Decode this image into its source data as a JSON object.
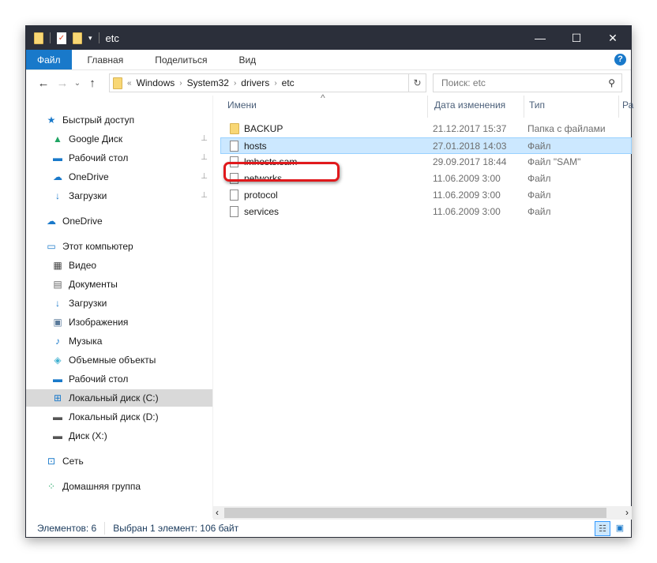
{
  "title": "etc",
  "window_controls": {
    "minimize": "—",
    "maximize": "☐",
    "close": "✕"
  },
  "ribbon": {
    "tabs": [
      "Файл",
      "Главная",
      "Поделиться",
      "Вид"
    ],
    "help": "?"
  },
  "address": {
    "overflow": "«",
    "parts": [
      "Windows",
      "System32",
      "drivers",
      "etc"
    ],
    "refresh": "↻",
    "search_placeholder": "Поиск: etc",
    "search_icon": "⚲"
  },
  "nav": {
    "back": "←",
    "forward": "→",
    "recent": "⌄",
    "up": "↑"
  },
  "sidebar": {
    "items": [
      {
        "label": "Быстрый доступ",
        "icon": "star-icon",
        "glyph": "★",
        "color": "#1979ca"
      },
      {
        "label": "Google Диск",
        "icon": "google-drive-icon",
        "glyph": "▲",
        "color": "#1fa463",
        "pinned": true
      },
      {
        "label": "Рабочий стол",
        "icon": "desktop-icon",
        "glyph": "▬",
        "color": "#1979ca",
        "pinned": true
      },
      {
        "label": "OneDrive",
        "icon": "onedrive-icon",
        "glyph": "☁",
        "color": "#1979ca",
        "pinned": true
      },
      {
        "label": "Загрузки",
        "icon": "downloads-icon",
        "glyph": "↓",
        "color": "#1979ca",
        "pinned": true
      },
      {
        "label": "OneDrive",
        "icon": "onedrive-icon",
        "glyph": "☁",
        "color": "#1979ca"
      },
      {
        "label": "Этот компьютер",
        "icon": "computer-icon",
        "glyph": "▭",
        "color": "#1979ca"
      },
      {
        "label": "Видео",
        "icon": "video-icon",
        "glyph": "▦",
        "color": "#444"
      },
      {
        "label": "Документы",
        "icon": "documents-icon",
        "glyph": "▤",
        "color": "#666"
      },
      {
        "label": "Загрузки",
        "icon": "downloads-icon",
        "glyph": "↓",
        "color": "#1979ca"
      },
      {
        "label": "Изображения",
        "icon": "pictures-icon",
        "glyph": "▣",
        "color": "#5a7a9a"
      },
      {
        "label": "Музыка",
        "icon": "music-icon",
        "glyph": "♪",
        "color": "#1979ca"
      },
      {
        "label": "Объемные объекты",
        "icon": "3d-objects-icon",
        "glyph": "◈",
        "color": "#3fb0d0"
      },
      {
        "label": "Рабочий стол",
        "icon": "desktop-icon",
        "glyph": "▬",
        "color": "#1979ca"
      },
      {
        "label": "Локальный диск (C:)",
        "icon": "windows-drive-icon",
        "glyph": "⊞",
        "color": "#1979ca",
        "selected": true
      },
      {
        "label": "Локальный диск (D:)",
        "icon": "drive-icon",
        "glyph": "▬",
        "color": "#555"
      },
      {
        "label": "Диск (X:)",
        "icon": "drive-icon",
        "glyph": "▬",
        "color": "#555"
      },
      {
        "label": "Сеть",
        "icon": "network-icon",
        "glyph": "⊡",
        "color": "#1979ca"
      },
      {
        "label": "Домашняя группа",
        "icon": "homegroup-icon",
        "glyph": "⁘",
        "color": "#1fa463"
      }
    ],
    "pin_glyph": "📌"
  },
  "columns": {
    "name": "Имени",
    "date": "Дата изменения",
    "type": "Тип",
    "size": "Ра",
    "sort": "^"
  },
  "files": [
    {
      "name": "BACKUP",
      "date": "21.12.2017 15:37",
      "type": "Папка с файлами",
      "folder": true
    },
    {
      "name": "hosts",
      "date": "27.01.2018 14:03",
      "type": "Файл",
      "selected": true
    },
    {
      "name": "lmhosts.sam",
      "date": "29.09.2017 18:44",
      "type": "Файл \"SAM\""
    },
    {
      "name": "networks",
      "date": "11.06.2009 3:00",
      "type": "Файл"
    },
    {
      "name": "protocol",
      "date": "11.06.2009 3:00",
      "type": "Файл"
    },
    {
      "name": "services",
      "date": "11.06.2009 3:00",
      "type": "Файл"
    }
  ],
  "scroll": {
    "left": "‹",
    "right": "›"
  },
  "status": {
    "count": "Элементов: 6",
    "selection": "Выбран 1 элемент: 106 байт"
  },
  "highlight_color": "#e0191c"
}
